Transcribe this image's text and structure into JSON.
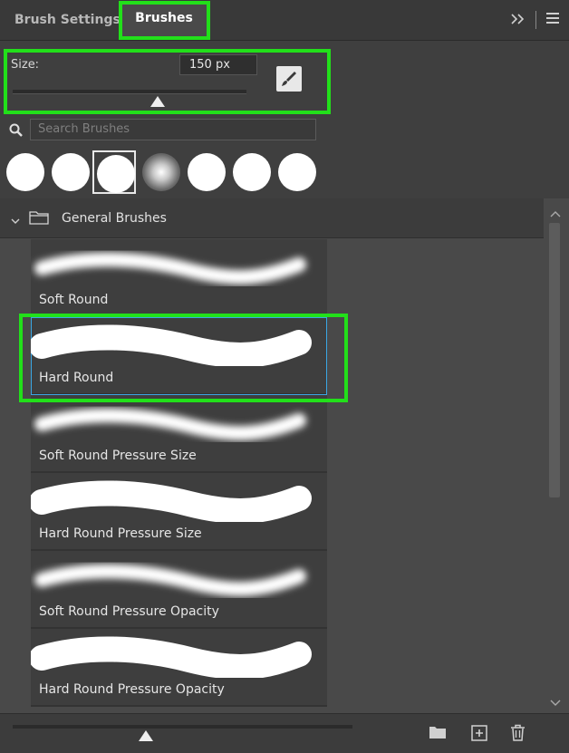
{
  "tabs": [
    {
      "label": "Brush Settings",
      "active": false
    },
    {
      "label": "Brushes",
      "active": true
    }
  ],
  "size": {
    "label": "Size:",
    "value": "150 px",
    "slider_fraction": 0.62
  },
  "search": {
    "placeholder": "Search Brushes"
  },
  "presets": [
    {
      "type": "hard",
      "selected": false
    },
    {
      "type": "hard",
      "selected": false
    },
    {
      "type": "hard",
      "selected": true
    },
    {
      "type": "soft",
      "selected": false
    },
    {
      "type": "hard",
      "selected": false
    },
    {
      "type": "hard",
      "selected": false
    },
    {
      "type": "hard",
      "selected": false
    }
  ],
  "folder": {
    "label": "General Brushes",
    "expanded": true
  },
  "brushes": [
    {
      "name": "Soft Round",
      "style": "soft",
      "selected": false
    },
    {
      "name": "Hard Round",
      "style": "hard",
      "selected": true
    },
    {
      "name": "Soft Round Pressure Size",
      "style": "soft",
      "selected": false
    },
    {
      "name": "Hard Round Pressure Size",
      "style": "hard",
      "selected": false
    },
    {
      "name": "Soft Round Pressure Opacity",
      "style": "soft",
      "selected": false
    },
    {
      "name": "Hard Round Pressure Opacity",
      "style": "hard",
      "selected": false
    }
  ],
  "colors": {
    "highlight": "#22e01a",
    "selection": "#3aa7e4",
    "panel_bg": "#3f3f3f"
  },
  "icons": [
    "collapse-panel-icon",
    "panel-menu-icon",
    "brush-tool-icon",
    "search-icon",
    "folder-icon",
    "chevron-down-icon",
    "new-group-icon",
    "new-brush-icon",
    "trash-icon"
  ]
}
